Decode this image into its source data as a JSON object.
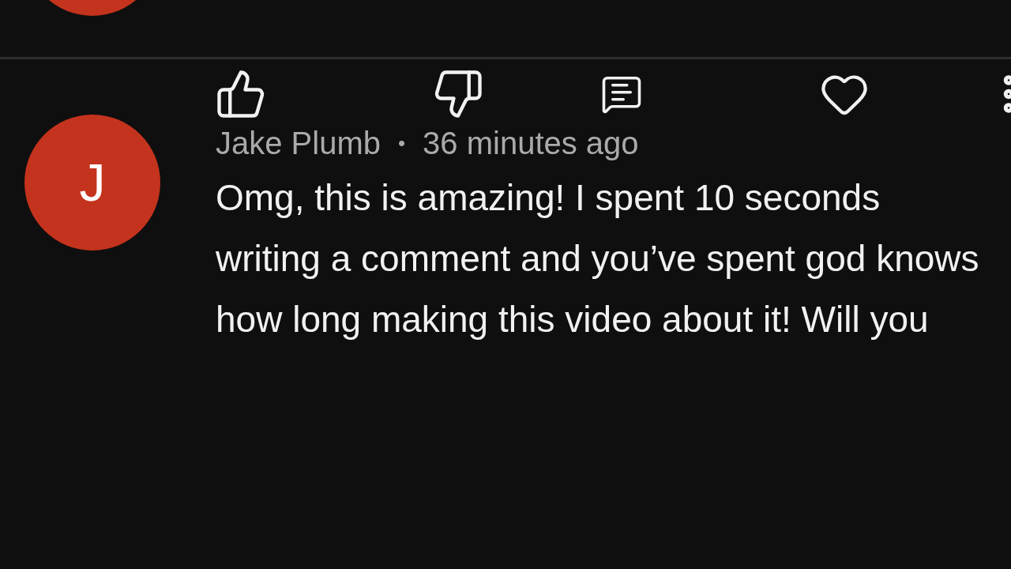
{
  "previous_comment": {
    "actions": [
      {
        "kind": "like"
      },
      {
        "kind": "dislike"
      },
      {
        "kind": "reply"
      },
      {
        "kind": "heart"
      },
      {
        "kind": "more"
      }
    ]
  },
  "comment": {
    "avatar_letter": "J",
    "author": "Jake Plumb",
    "separator": "•",
    "time": "36 minutes ago",
    "text": "Omg, this is amazing! I spent 10 seconds writing a comment and you’ve spent god knows how long making this video about it! Will you"
  }
}
